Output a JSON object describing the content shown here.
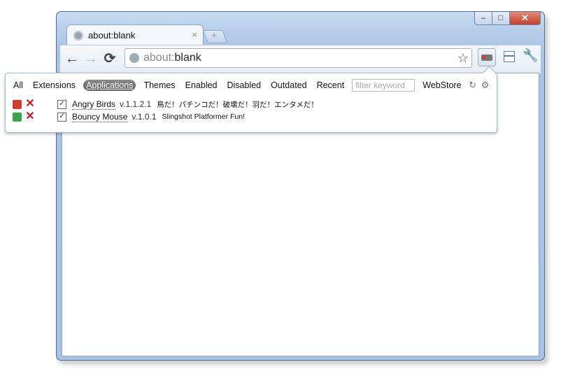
{
  "window": {
    "min": "–",
    "max": "□",
    "close": "✕"
  },
  "tab": {
    "title": "about:blank",
    "close": "×"
  },
  "newtab": {
    "plus": "+"
  },
  "toolbar": {
    "back": "←",
    "forward": "→",
    "reload": "⟳",
    "url_scheme": "about:",
    "url_rest": "blank",
    "star": "☆",
    "wrench": "🔧"
  },
  "popup": {
    "filters": [
      "All",
      "Extensions",
      "Applications",
      "Themes",
      "Enabled",
      "Disabled",
      "Outdated",
      "Recent"
    ],
    "active_filter": "Applications",
    "search_placeholder": "filter keyword",
    "webstore": "WebStore",
    "items": [
      {
        "name": "Angry Birds",
        "version": "v.1.1.2.1",
        "description": "鳥だ！パチンコだ！破壊だ！羽だ！エンタメだ！",
        "enabled": true,
        "icon_color": "#d43c2c"
      },
      {
        "name": "Bouncy Mouse",
        "version": "v.1.0.1",
        "description": "Slingshot Platformer Fun!",
        "enabled": true,
        "icon_color": "#3aa64a"
      }
    ]
  }
}
